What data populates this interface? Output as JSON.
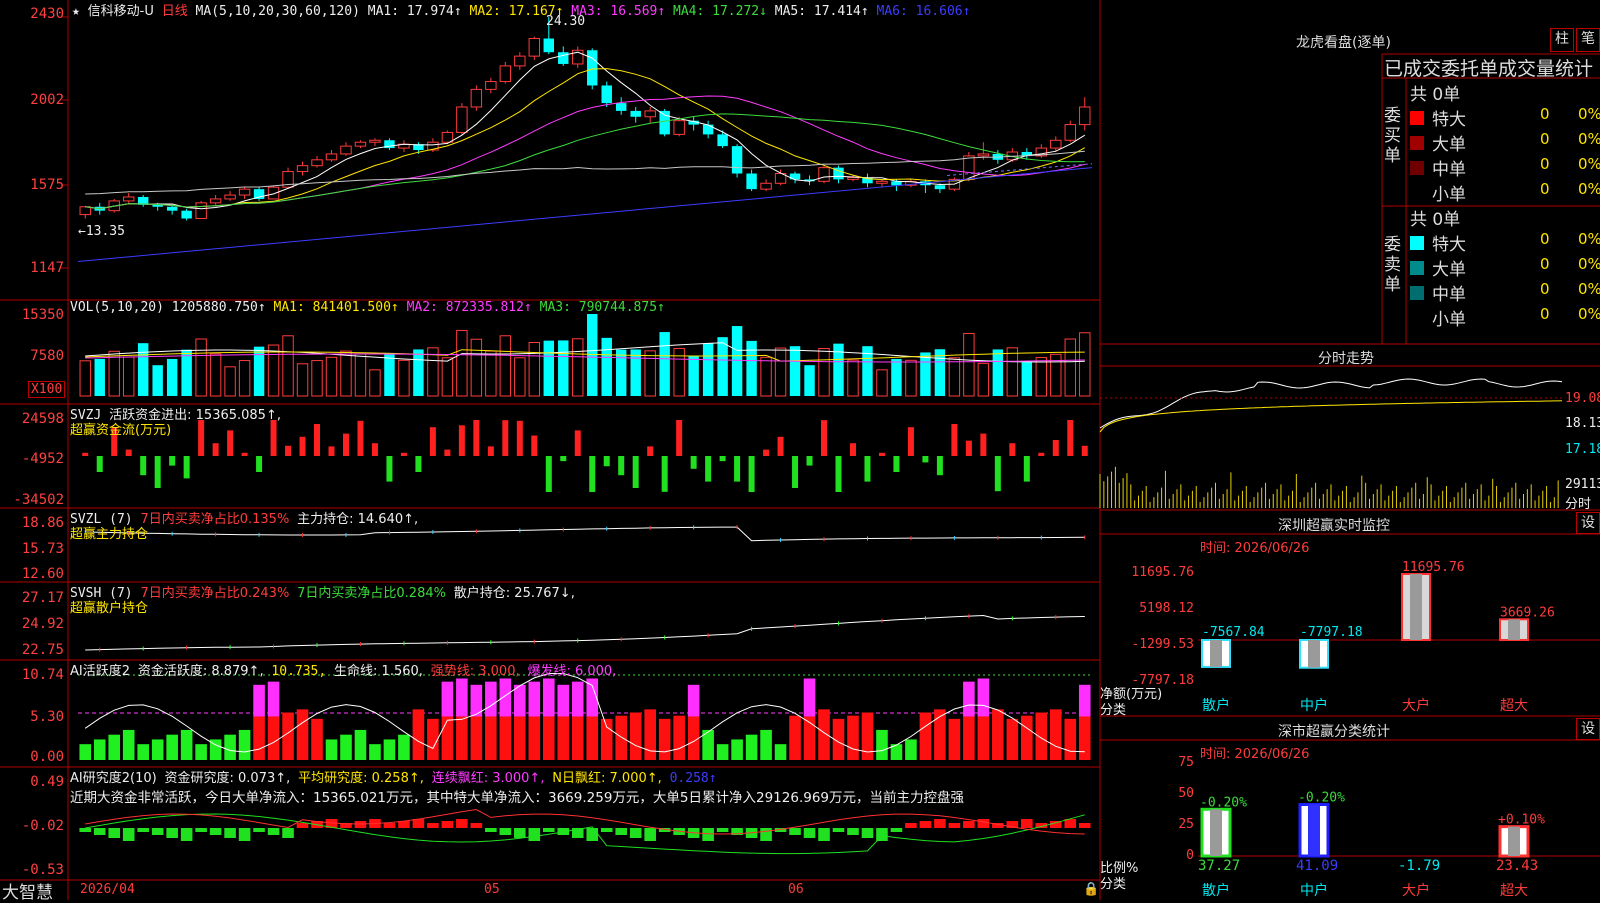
{
  "header": {
    "star": "★",
    "title": "信科移动-U",
    "period": "日线",
    "ma_params": "MA(5,10,20,30,60,120)",
    "ma1": "MA1: 17.974↑",
    "ma2": "MA2: 17.167↑",
    "ma3": "MA3: 16.569↑",
    "ma4": "MA4: 17.272↓",
    "ma5": "MA5: 17.414↑",
    "ma6": "MA6: 16.606↑",
    "high_mark": "24.30",
    "low_mark": "←13.35"
  },
  "price_axis": [
    "2430",
    "2002",
    "1575",
    "1147"
  ],
  "vol": {
    "head": "VOL(5,10,20)",
    "value": "1205880.750↑",
    "ma1": "MA1: 841401.500↑",
    "ma2": "MA2: 872335.812↑",
    "ma3": "MA3: 790744.875↑",
    "axis": [
      "15350",
      "7580"
    ],
    "unit": "X100"
  },
  "svzj": {
    "head": "SVZJ",
    "label": "活跃资金进出: 15365.085↑,",
    "sub": "超赢资金流(万元)",
    "axis": [
      "24598",
      "-4952",
      "-34502"
    ]
  },
  "svzl": {
    "head": "SVZL (7)",
    "ratio": "7日内买卖净占比0.135%",
    "hold": "主力持仓: 14.640↑,",
    "sub": "超赢主力持仓",
    "axis": [
      "18.86",
      "15.73",
      "12.60"
    ]
  },
  "svsh": {
    "head": "SVSH (7)",
    "ratio1": "7日内买卖净占比0.243%",
    "ratio2": "7日内买卖净占比0.284%",
    "hold": "散户持仓: 25.767↓,",
    "sub": "超赢散户持仓",
    "axis": [
      "27.17",
      "24.92",
      "22.75"
    ]
  },
  "ai_active": {
    "head": "AI活跃度2",
    "val1": "资金活跃度: 8.879↑,",
    "val2": "10.735,",
    "val3": "生命线: 1.560,",
    "val4": "强势线: 3.000,",
    "val5": "爆发线: 6.000,",
    "axis": [
      "10.74",
      "5.30",
      "0.00"
    ]
  },
  "ai_research": {
    "head": "AI研究度2(10)",
    "val1": "资金研究度: 0.073↑,",
    "val2": "平均研究度: 0.258↑,",
    "val3": "连续飘红: 3.000↑,",
    "val4": "N日飘红: 7.000↑,",
    "val5": "0.258↑",
    "summary": "近期大资金非常活跃，今日大单净流入：15365.021万元，其中特大单净流入：3669.259万元，大单5日累计净入29126.969万元，当前主力控盘强",
    "axis": [
      "0.49",
      "-0.02",
      "-0.53"
    ]
  },
  "bottom": {
    "brand": "大智慧",
    "dates": [
      "2026/04",
      "05",
      "06"
    ]
  },
  "right_panel": {
    "tab_bar": "柱",
    "tab_pen": "笔",
    "dragon_title": "龙虎看盘(逐单)",
    "table_title": "已成交委托单成交量统计",
    "buy_side": "委买单",
    "sell_side": "委卖单",
    "buy_total": "共 0单",
    "sell_total": "共 0单",
    "buy_rows": [
      {
        "name": "特大",
        "count": "0",
        "pct": "0%",
        "color": "#ff0000"
      },
      {
        "name": "大单",
        "count": "0",
        "pct": "0%",
        "color": "#a00000"
      },
      {
        "name": "中单",
        "count": "0",
        "pct": "0%",
        "color": "#700000"
      },
      {
        "name": "小单",
        "count": "0",
        "pct": "0%",
        "color": "#000000"
      }
    ],
    "sell_rows": [
      {
        "name": "特大",
        "count": "0",
        "pct": "0%",
        "color": "#00ffff"
      },
      {
        "name": "大单",
        "count": "0",
        "pct": "0%",
        "color": "#008c8c"
      },
      {
        "name": "中单",
        "count": "0",
        "pct": "0%",
        "color": "#006e6e"
      },
      {
        "name": "小单",
        "count": "0",
        "pct": "0%",
        "color": "#000000"
      }
    ],
    "intraday_title": "分时走势",
    "intraday_axis": [
      "19.08",
      "18.13",
      "17.18",
      "29113",
      "分时"
    ],
    "sz_monitor": {
      "title": "深圳超赢实时监控",
      "set": "设",
      "time": "时间: 2026/06/26",
      "axis": [
        "11695.76",
        "5198.12",
        "-1299.53",
        "-7797.18"
      ],
      "ylabel": "净额(万元)",
      "xlabel": "分类",
      "categories": [
        "散户",
        "中户",
        "大户",
        "超大"
      ],
      "values": [
        -7567.84,
        -7797.18,
        11695.76,
        3669.26
      ],
      "labels": [
        "-7567.84",
        "-7797.18",
        "11695.76",
        "3669.26"
      ]
    },
    "sz_class": {
      "title": "深市超赢分类统计",
      "set": "设",
      "time": "时间: 2026/06/26",
      "axis": [
        "75",
        "50",
        "25",
        "0"
      ],
      "ylabel": "比例%",
      "xlabel": "分类",
      "categories": [
        "散户",
        "中户",
        "大户",
        "超大"
      ],
      "values": [
        37.27,
        41.09,
        -1.79,
        23.43
      ],
      "value_labels": [
        "37.27",
        "41.09",
        "-1.79",
        "23.43"
      ],
      "change_labels": [
        "-0.20%",
        "-0.20%",
        "",
        "+0.10%"
      ]
    }
  },
  "colors": {
    "up": "#ff3c3c",
    "down": "#00ffff",
    "grid": "#b00000",
    "ma1": "#ffffff",
    "ma2": "#ffe600",
    "ma3": "#ff3cff",
    "ma4": "#3cdc3c",
    "ma5": "#c8c8c8",
    "ma6": "#3c3cff"
  },
  "candles": [
    [
      14.2,
      14.6,
      14.0,
      14.6
    ],
    [
      14.6,
      14.4,
      14.2,
      14.8
    ],
    [
      14.4,
      14.9,
      14.3,
      15.0
    ],
    [
      14.9,
      15.1,
      14.8,
      15.3
    ],
    [
      15.1,
      14.7,
      14.6,
      15.2
    ],
    [
      14.7,
      14.6,
      14.4,
      14.8
    ],
    [
      14.6,
      14.4,
      14.2,
      14.7
    ],
    [
      14.4,
      14.0,
      13.9,
      14.5
    ],
    [
      14.0,
      14.8,
      14.0,
      14.9
    ],
    [
      14.8,
      15.0,
      14.7,
      15.2
    ],
    [
      15.0,
      15.2,
      14.9,
      15.4
    ],
    [
      15.2,
      15.5,
      15.0,
      15.6
    ],
    [
      15.5,
      15.0,
      14.9,
      15.6
    ],
    [
      15.0,
      15.6,
      15.0,
      15.7
    ],
    [
      15.6,
      16.4,
      15.6,
      16.6
    ],
    [
      16.4,
      16.7,
      16.2,
      16.9
    ],
    [
      16.7,
      17.0,
      16.6,
      17.2
    ],
    [
      17.0,
      17.3,
      16.9,
      17.5
    ],
    [
      17.3,
      17.7,
      17.2,
      17.9
    ],
    [
      17.7,
      17.9,
      17.6,
      18.0
    ],
    [
      17.9,
      18.0,
      17.7,
      18.1
    ],
    [
      18.0,
      17.6,
      17.5,
      18.1
    ],
    [
      17.6,
      17.8,
      17.4,
      18.0
    ],
    [
      17.8,
      17.5,
      17.3,
      17.9
    ],
    [
      17.5,
      17.9,
      17.4,
      18.1
    ],
    [
      17.9,
      18.4,
      17.8,
      18.5
    ],
    [
      18.4,
      19.7,
      18.3,
      19.9
    ],
    [
      19.7,
      20.6,
      19.5,
      20.8
    ],
    [
      20.6,
      21.0,
      20.4,
      21.2
    ],
    [
      21.0,
      21.8,
      20.9,
      22.0
    ],
    [
      21.8,
      22.3,
      21.6,
      22.5
    ],
    [
      22.3,
      23.2,
      22.1,
      23.3
    ],
    [
      23.2,
      22.5,
      22.4,
      24.3
    ],
    [
      22.5,
      21.9,
      21.8,
      22.8
    ],
    [
      21.9,
      22.6,
      21.7,
      22.8
    ],
    [
      22.6,
      20.8,
      20.6,
      22.7
    ],
    [
      20.8,
      19.9,
      19.7,
      21.0
    ],
    [
      19.9,
      19.5,
      19.3,
      20.2
    ],
    [
      19.5,
      19.2,
      18.9,
      19.7
    ],
    [
      19.2,
      19.5,
      18.9,
      19.7
    ],
    [
      19.5,
      18.3,
      18.2,
      19.6
    ],
    [
      18.3,
      19.0,
      18.2,
      19.2
    ],
    [
      19.0,
      18.8,
      18.5,
      19.2
    ],
    [
      18.8,
      18.3,
      18.1,
      19.0
    ],
    [
      18.3,
      17.7,
      17.6,
      18.5
    ],
    [
      17.7,
      16.3,
      16.1,
      17.8
    ],
    [
      16.3,
      15.5,
      15.4,
      16.5
    ],
    [
      15.5,
      15.8,
      15.4,
      16.0
    ],
    [
      15.8,
      16.3,
      15.7,
      16.5
    ],
    [
      16.3,
      16.0,
      15.8,
      16.4
    ],
    [
      16.0,
      15.9,
      15.7,
      16.2
    ],
    [
      15.9,
      16.6,
      15.8,
      16.7
    ],
    [
      16.6,
      16.0,
      15.8,
      16.7
    ],
    [
      16.0,
      16.1,
      15.9,
      16.2
    ],
    [
      16.1,
      15.8,
      15.6,
      16.3
    ],
    [
      15.8,
      15.9,
      15.6,
      16.0
    ],
    [
      15.9,
      15.7,
      15.4,
      16.0
    ],
    [
      15.7,
      15.9,
      15.6,
      16.0
    ],
    [
      15.9,
      15.7,
      15.3,
      16.0
    ],
    [
      15.7,
      15.5,
      15.3,
      15.8
    ],
    [
      15.5,
      16.0,
      15.4,
      16.1
    ],
    [
      16.0,
      17.2,
      15.9,
      17.4
    ],
    [
      17.2,
      17.3,
      17.0,
      17.9
    ],
    [
      17.3,
      17.0,
      16.8,
      17.5
    ],
    [
      17.0,
      17.4,
      16.9,
      17.6
    ],
    [
      17.4,
      17.2,
      17.0,
      17.6
    ],
    [
      17.2,
      17.6,
      17.1,
      17.8
    ],
    [
      17.6,
      18.0,
      17.4,
      18.2
    ],
    [
      18.0,
      18.8,
      17.9,
      19.0
    ],
    [
      18.8,
      19.7,
      18.5,
      20.2
    ]
  ]
}
